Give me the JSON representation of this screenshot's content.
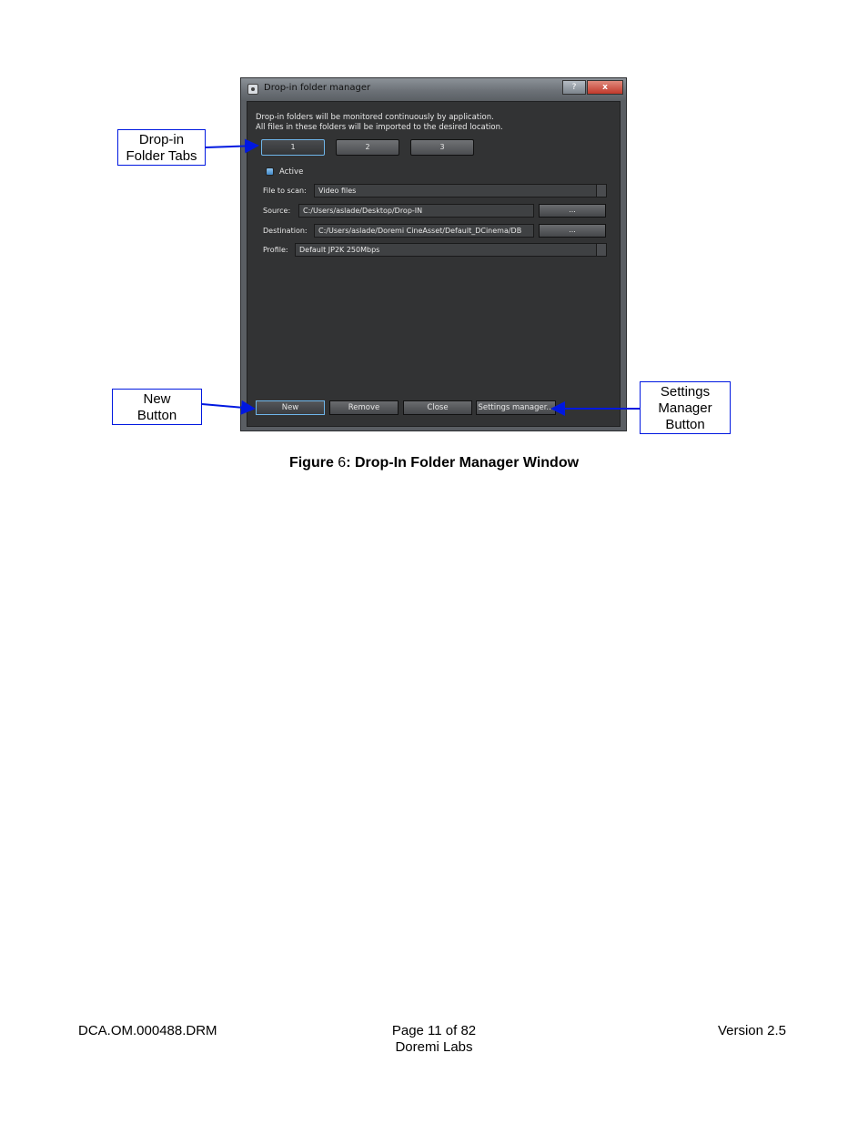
{
  "window": {
    "title": "Drop-in folder manager",
    "help_button": "?",
    "close_button": "x",
    "info_line1": "Drop-in folders will be monitored continuously by application.",
    "info_line2": "All files in these folders will be imported to the desired location.",
    "tabs": [
      {
        "label": "1"
      },
      {
        "label": "2"
      },
      {
        "label": "3"
      }
    ],
    "active_label": "Active",
    "active_checked": true,
    "file_to_scan_label": "File to scan:",
    "file_to_scan_value": "Video files",
    "source_label": "Source:",
    "source_value": "C:/Users/aslade/Desktop/Drop-IN",
    "destination_label": "Destination:",
    "destination_value": "C:/Users/aslade/Doremi CineAsset/Default_DCinema/DB",
    "profile_label": "Profile:",
    "profile_value": "Default JP2K 250Mbps",
    "browse_label": "...",
    "buttons": {
      "new": "New",
      "remove": "Remove",
      "close": "Close",
      "settings": "Settings manager..."
    }
  },
  "callouts": {
    "tabs_line1": "Drop-in",
    "tabs_line2": "Folder Tabs",
    "new_line1": "New",
    "new_line2": "Button",
    "settings_line1": "Settings",
    "settings_line2": "Manager",
    "settings_line3": "Button"
  },
  "caption": {
    "prefix": "Figure ",
    "number": "6",
    "text": ": Drop-In Folder Manager Window"
  },
  "footer": {
    "doc_id": "DCA.OM.000488.DRM",
    "page": "Page 11 of 82",
    "company": "Doremi Labs",
    "version": "Version 2.5"
  },
  "colors": {
    "callout_border": "#0018e0",
    "window_bg": "#323334",
    "focus_blue": "#6fb6ea"
  }
}
